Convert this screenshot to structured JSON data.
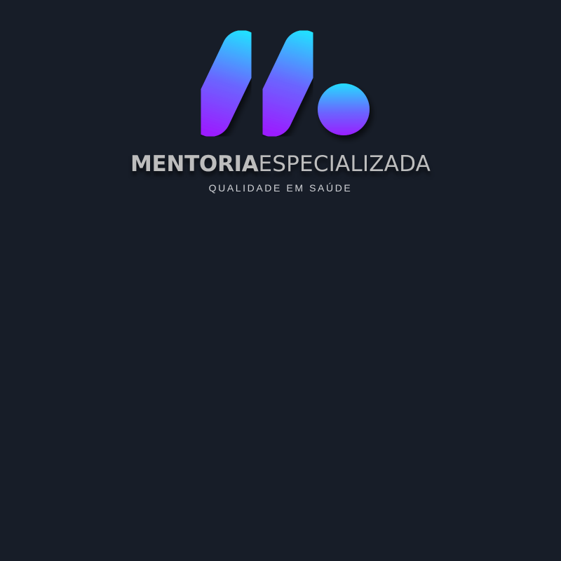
{
  "logo": {
    "mark_icon": "stylized-m-with-dot-icon",
    "brand_bold": "MENTORIA",
    "brand_light": "ESPECIALIZADA",
    "tagline": "QUALIDADE EM SAÚDE"
  },
  "colors": {
    "background": "#171d28",
    "gradient_top": "#22e0ff",
    "gradient_bottom": "#9b1cff",
    "text": "#bdbdbd"
  }
}
